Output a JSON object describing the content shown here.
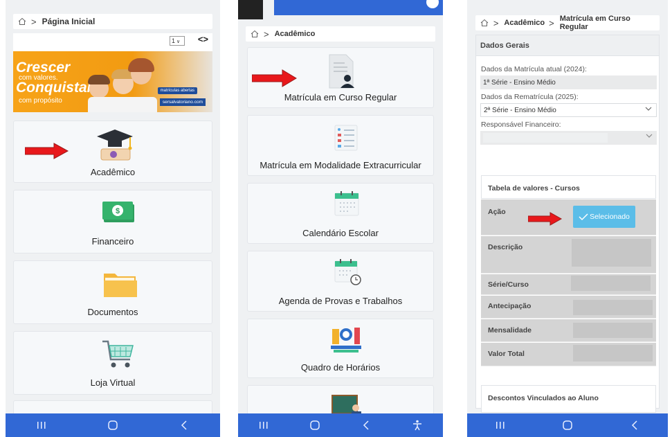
{
  "panel1": {
    "breadcrumb": [
      "Página Inicial"
    ],
    "pager": {
      "selected": "1",
      "arrows": "<>"
    },
    "banner": {
      "line1": "Crescer",
      "line2": "com valores.",
      "line3": "Conquistar",
      "line4": "com propósito",
      "badge": "matrículas abertas",
      "url": "sersalvatoriano.com"
    },
    "cards": [
      {
        "label": "Acadêmico",
        "icon": "graduation-cap-icon"
      },
      {
        "label": "Financeiro",
        "icon": "banknote-icon"
      },
      {
        "label": "Documentos",
        "icon": "folder-icon"
      },
      {
        "label": "Loja Virtual",
        "icon": "shopping-cart-icon"
      }
    ]
  },
  "panel2": {
    "breadcrumb": [
      "Acadêmico"
    ],
    "cards": [
      {
        "label": "Matrícula em Curso Regular",
        "icon": "user-document-icon"
      },
      {
        "label": "Matrícula em Modalidade Extracurricular",
        "icon": "list-document-icon"
      },
      {
        "label": "Calendário Escolar",
        "icon": "calendar-icon"
      },
      {
        "label": "Agenda de Provas e Trabalhos",
        "icon": "calendar-clock-icon"
      },
      {
        "label": "Quadro de Horários",
        "icon": "timetable-icon"
      }
    ]
  },
  "panel3": {
    "breadcrumb": [
      "Acadêmico",
      "Matrícula em Curso Regular"
    ],
    "section_title": "Dados Gerais",
    "current_label": "Dados da Matrícula atual (2024):",
    "current_value": "1ª Série - Ensino Médio",
    "renewal_label": "Dados da Rematrícula (2025):",
    "renewal_value": "2ª Série - Ensino Médio",
    "guardian_label": "Responsável Financeiro:",
    "table_title": "Tabela de valores - Cursos",
    "rows": [
      "Ação",
      "Descrição",
      "Série/Curso",
      "Antecipação",
      "Mensalidade",
      "Valor Total"
    ],
    "selected_button": "Selecionado",
    "discounts_title": "Descontos Vinculados ao Aluno"
  },
  "colors": {
    "nav": "#3168d5",
    "arrow": "#e8181b",
    "selected": "#5bbde8"
  }
}
